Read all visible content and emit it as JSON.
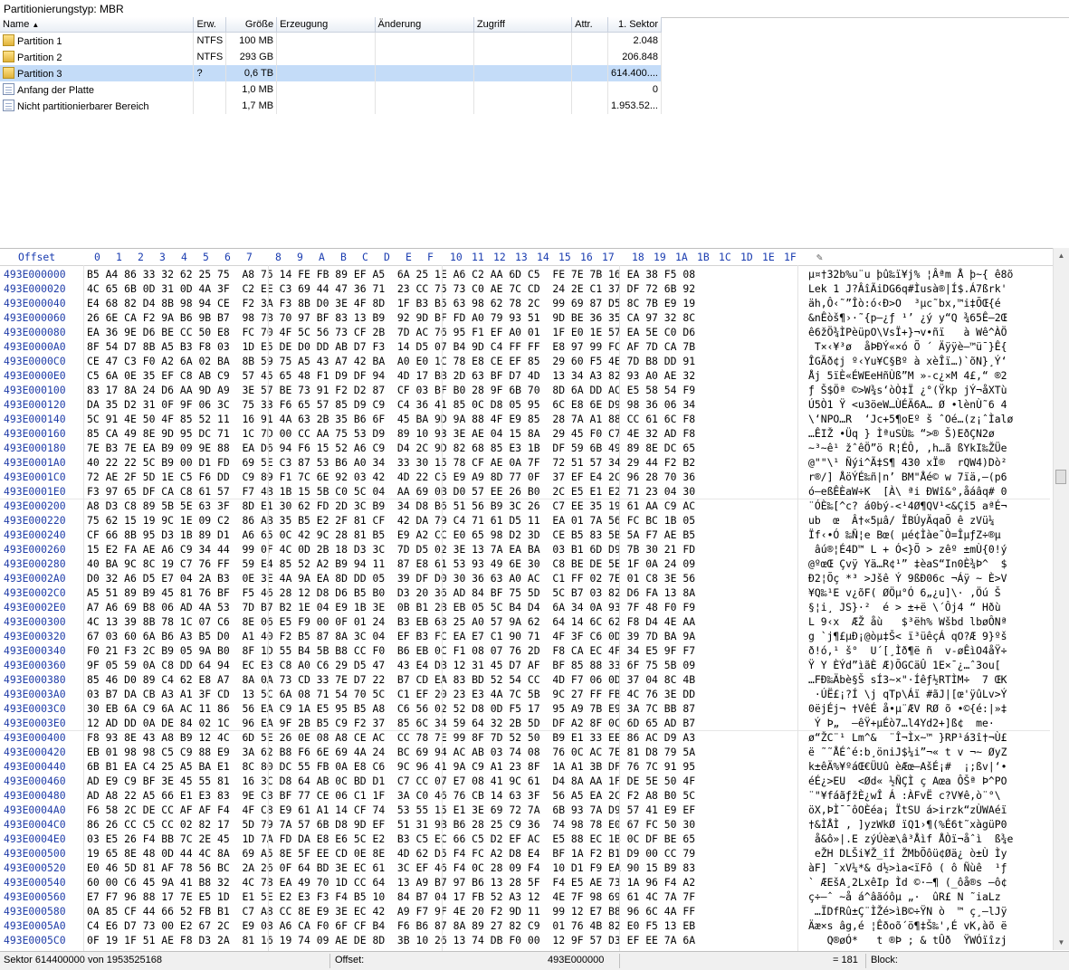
{
  "partition_type": "Partitionierungstyp: MBR",
  "columns": [
    "Name",
    "Erw.",
    "Größe",
    "Erzeugung",
    "Änderung",
    "Zugriff",
    "Attr.",
    "1. Sektor"
  ],
  "sort_indicator": "▲",
  "rows": [
    {
      "name": "Partition 1",
      "ext": "NTFS",
      "size": "100 MB",
      "sector": "2.048",
      "icon": "partition-icon"
    },
    {
      "name": "Partition 2",
      "ext": "NTFS",
      "size": "293 GB",
      "sector": "206.848",
      "icon": "partition-icon"
    },
    {
      "name": "Partition 3",
      "ext": "?",
      "size": "0,6 TB",
      "sector": "614.400....",
      "icon": "partition-icon",
      "selected": true
    },
    {
      "name": "Anfang der Platte",
      "ext": "",
      "size": "1,0 MB",
      "sector": "0",
      "icon": "file-icon"
    },
    {
      "name": "Nicht partitionierbarer Bereich",
      "ext": "",
      "size": "1,7 MB",
      "sector": "1.953.52...",
      "icon": "file-icon"
    }
  ],
  "hex_header": {
    "offset_label": "Offset",
    "cols": [
      "0",
      "1",
      "2",
      "3",
      "4",
      "5",
      "6",
      "7",
      "8",
      "9",
      "A",
      "B",
      "C",
      "D",
      "E",
      "F",
      "10",
      "11",
      "12",
      "13",
      "14",
      "15",
      "16",
      "17",
      "18",
      "19",
      "1A",
      "1B",
      "1C",
      "1D",
      "1E",
      "1F"
    ]
  },
  "hex_rows": [
    {
      "off": "493E000000",
      "hex": "B5 A4 86 33 32 62 25 75  A8 75 14 FE FB 89 EF A5  6A 25 1E A6 C2 AA 6D C5  FE 7E 7B 16 EA 38 F5 08",
      "txt": "µ¤†32b%u¨u þû‰ï¥j% ¦Âªm Å þ~{ ê8õ"
    },
    {
      "off": "493E000020",
      "hex": "4C 65 6B 0D 31 0D 4A 3F  C2 EE C3 69 44 47 36 71  23 CC 75 73 C0 AE 7C CD  24 2E C1 37 DF 72 6B 92",
      "txt": "Lek 1 J?ÂîÃiDG6q#Ìusà®|Í$.Á7ßrk'"
    },
    {
      "off": "493E000040",
      "hex": "E4 68 82 D4 8B 98 94 CE  F2 3A F3 8B D0 3E 4F 8D  1F B3 B5 63 98 62 78 2C  99 69 87 D5 8C 7B E9 19",
      "txt": "äh‚Ô‹˜”Îò:ó‹Ð>O  ³µc˜bx,™i‡ÕŒ{é "
    },
    {
      "off": "493E000060",
      "hex": "26 6E CA F2 9A B6 9B B7  98 7B 70 97 BF 83 13 B9  92 9D BF FD A0 79 93 51  9D BE 36 35 CA 97 32 8C",
      "txt": "&nÊòš¶›·˜{p—¿ƒ ¹’ ¿ý y“Q ¾65Ê—2Œ"
    },
    {
      "off": "493E000080",
      "hex": "EA 36 9E D6 BE CC 50 E8  FC 70 4F 5C 56 73 CF 2B  7D AC 76 95 F1 EF A0 01  1F E0 1E 57 EA 5E C0 D6",
      "txt": "ê6žÖ¾ÌPèüpO\\VsÏ+}¬v•ñï   à Wê^ÀÖ"
    },
    {
      "off": "493E0000A0",
      "hex": "8F 54 D7 8B A5 B3 F8 03  1D E5 DE D0 DD AB D7 F3  14 D5 07 B4 9D C4 FF FF  E8 97 99 FC AF 7D CA 7B",
      "txt": " T×‹¥³ø  åÞÐÝ«×ó Õ ´ Äÿÿè—™ü¯}Ê{"
    },
    {
      "off": "493E0000C0",
      "hex": "CE 47 C3 F0 A2 6A 02 BA  8B 59 75 A5 43 A7 42 BA  A0 E0 1C 78 E8 CE EF 85  29 60 F5 4E 7D B8 DD 91",
      "txt": "ÎGÃð¢j º‹Yu¥C§Bº à xèÎï…)`õN}¸Ý‘"
    },
    {
      "off": "493E0000E0",
      "hex": "C5 6A 0E 35 EF C8 AB C9  57 45 65 48 F1 D9 DF 94  4D 17 BB 2D 63 BF D7 4D  13 34 A3 82 93 A0 AE 32",
      "txt": "Åj 5ïÈ«ÉWEeHñÙß”M »-c¿×M 4£‚“ ®2"
    },
    {
      "off": "493E000100",
      "hex": "83 17 8A 24 D6 AA 9D A9  3E 57 BE 73 91 F2 D2 87  CF 03 BF B0 28 9F 6B 70  8D 6A DD AC E5 58 54 F9",
      "txt": "ƒ Š$Öª ©>W¾s‘òÒ‡Ï ¿°(Ÿkp jÝ¬åXTù"
    },
    {
      "off": "493E000120",
      "hex": "DA 35 D2 31 0F 9F 06 3C  75 33 F6 65 57 85 D9 C9  C4 36 41 85 0C D8 05 95  6C E8 6E D9 98 36 06 34",
      "txt": "Ú5Ò1 Ÿ <u3öeW…ÙÉÄ6A… Ø •lènÙ˜6 4"
    },
    {
      "off": "493E000140",
      "hex": "5C 91 4E 50 4F 85 52 11  16 91 4A 63 2B 35 B6 6F  45 BA 9D 9A 88 4F E9 85  28 7A A1 88 CC 61 6C F8",
      "txt": "\\‘NPO…R  ‘Jc+5¶oEº š ˆOé…(z¡ˆÌalø"
    },
    {
      "off": "493E000160",
      "hex": "85 CA 49 8E 9D 95 DC 71  1C 7D 00 CC AA 75 53 D9  89 10 93 3E AE 04 15 8A  29 45 F0 C7 4E 32 AD F8",
      "txt": "…ÊIŽ •Üq } ÌªuSÙ‰ “>® Š)EðÇN2­ø"
    },
    {
      "off": "493E000180",
      "hex": "7E B3 7E EA B9 09 9E 88  EA D6 94 F6 15 52 A6 C9  D4 2C 9D 82 68 85 E3 1B  DF 59 6B 49 89 8E DC 65",
      "txt": "~³~ê¹ žˆêÖ”ö R¦ÉÔ, ‚h…ã ßYkI‰ŽÜe"
    },
    {
      "off": "493E0001A0",
      "hex": "40 22 22 5C B9 00 D1 FD  69 5E C3 87 53 B6 A0 34  33 30 15 78 CF AE 0A 7F  72 51 57 34 29 44 F2 B2",
      "txt": "@\"\"\\¹ Ñýi^Ã‡S¶ 430 xÏ®  rQW4)Dò²"
    },
    {
      "off": "493E0001C0",
      "hex": "72 AE 2F 5D 1E C5 F6 DD  C9 89 F1 7C 6E 92 03 42  4D 22 C5 E9 A9 8D 77 0F  37 EF E4 2C 96 28 70 36",
      "txt": "r®/] ÅöÝÉ‰ñ|n’ BM\"Åé© w 7ïä,–(p6"
    },
    {
      "off": "493E0001E0",
      "hex": "F3 97 65 DF CA C8 61 57  F7 4B 1B 15 5B C0 5C 04  AA 69 0B D0 57 EE 26 B0  2C E5 E1 E2 71 23 04 30",
      "txt": "ó—eßÊÈaW÷K  [À\\ ªi ÐWî&°,åáâq# 0"
    },
    {
      "off": "493E000200",
      "hex": "A8 D3 C8 89 5B 5E 63 3F  8D E1 30 62 FD 2D 3C B9  34 D8 B6 51 56 B9 3C 26  C7 EE 35 19 61 AA C9 AC",
      "txt": "¨ÓÈ‰[^c? á0bý-<¹4Ø¶QV¹<&Çî5 aªÉ¬"
    },
    {
      "off": "493E000220",
      "hex": "75 62 15 19 9C 1E 09 C2  86 AB 35 B5 E2 2F 81 CF  42 DA 79 C4 71 61 D5 11  EA 01 7A 56 FC BC 1B 05",
      "txt": "ub  œ  Â†«5µâ/ ÏBÚyÄqaÕ ê zVü¼  "
    },
    {
      "off": "493E000240",
      "hex": "CF 66 8B 95 D3 1B 89 D1  A6 65 0C 42 9C 28 81 B5  E9 A2 CC E0 65 98 D2 3D  CE B5 83 5B 5A F7 AE B5",
      "txt": "Ïf‹•Ó ‰Ñ¦e Bœ( µé¢Ìàe˜Ò=ÎµƒZ÷®µ"
    },
    {
      "off": "493E000260",
      "hex": "15 E2 FA AE A6 C9 34 44  99 0F 4C 0D 2B 18 D3 3C  7D D5 02 3E 13 7A EA BA  03 B1 6D D9 7B 30 21 FD",
      "txt": " âú®¦É4D™ L + Ó<}Õ > zêº ±mÙ{0!ý"
    },
    {
      "off": "493E000280",
      "hex": "40 BA 9C 8C 19 C7 76 FF  59 E4 85 52 A2 B9 94 11  87 E8 61 53 93 49 6E 30  C8 BE DE 5E 1F 0A 24 09",
      "txt": "@ºœŒ Çvÿ Yä…R¢¹” ‡èaS“In0È¾Þ^  $ "
    },
    {
      "off": "493E0002A0",
      "hex": "D0 32 A6 D5 E7 04 2A B3  0E 3E 4A 9A EA 8D DD 05  39 DF D0 30 36 63 A0 AC  C1 FF 02 7E 01 C8 3E 56",
      "txt": "Ð2¦Õç *³ >Jšê Ý 9ßÐ06c ¬Áÿ ~ È>V"
    },
    {
      "off": "493E0002C0",
      "hex": "A5 51 89 B9 45 81 76 BF  F5 46 28 12 D8 D6 B5 B0  D3 20 36 AD 84 BF 75 5D  5C B7 03 82 D6 FA 13 8A",
      "txt": "¥Q‰¹E v¿õF( ØÖµ°Ó 6­„¿u]\\· ‚Öú Š"
    },
    {
      "off": "493E0002E0",
      "hex": "A7 A6 69 B8 06 AD 4A 53  7D B7 B2 1E 04 E9 1B 3E  0B B1 2B EB 05 5C B4 D4  6A 34 0A 93 7F 48 F0 F9",
      "txt": "§¦i¸ ­JS}·²  é > ±+ë \\´Ôj4 “ Hðù"
    },
    {
      "off": "493E000300",
      "hex": "4C 13 39 8B 78 1C 07 C6  8E 06 E5 F9 00 0F 01 24  B3 EB 68 25 A0 57 9A 62  64 14 6C 62 F8 D4 4E AA",
      "txt": "L 9‹x  ÆŽ åù   $³ëh% Wšbd lbøÔNª"
    },
    {
      "off": "493E000320",
      "hex": "67 03 60 6A B6 A3 B5 D0  A1 40 F2 B5 87 8A 3C 04  EF B3 FC EA E7 C1 90 71  4F 3F C6 0D 39 7D BA 9A",
      "txt": "g `j¶£µÐ¡@òµ‡Š< ï³üêçÁ qO?Æ 9}ºš"
    },
    {
      "off": "493E000340",
      "hex": "F0 21 F3 2C B9 05 9A B0  8F 1D 55 B4 5B B8 CC F0  B6 EB 0C F1 08 07 76 2D  F8 CA EC 4F 34 E5 9F F7",
      "txt": "ð!ó,¹ š°  U´[¸Ìð¶ë ñ  v-øÊìO4åŸ÷"
    },
    {
      "off": "493E000360",
      "hex": "9F 05 59 0A C8 DD 64 94  EC E3 C8 A0 C6 29 D5 47  43 E4 DB 12 31 45 D7 AF  BF 85 88 33 6F 75 5B 09",
      "txt": "Ÿ Y ÈÝd”ìãÈ Æ)ÕGCäÛ 1E×¯¿…ˆ3ou[ "
    },
    {
      "off": "493E000380",
      "hex": "85 46 D0 89 C4 62 E8 A7  8A 0A 73 CD 33 7E D7 22  B7 CD EA 83 BD 52 54 CC  4D F7 06 0D 37 04 8C 4B",
      "txt": "…FÐ‰Äbè§Š sÍ3~×\"·Íêƒ½RTÌM÷  7 ŒK"
    },
    {
      "off": "493E0003A0",
      "hex": "03 B7 DA CB A3 A1 3F CD  13 5C 6A 08 71 54 70 5C  C1 EF 20 23 E3 4A 7C 5B  9C 27 FF FB 4C 76 3E DD",
      "txt": " ·ÚË£¡?Í \\j qTp\\Áï #ãJ|[œ'ÿûLv>Ý"
    },
    {
      "off": "493E0003C0",
      "hex": "30 EB 6A C9 6A AC 11 86  56 EA C9 1A E5 95 B5 A8  C6 56 02 52 D8 0D F5 17  95 A9 7B E9 3A 7C BB 87",
      "txt": "0ëjÉj¬ †VêÉ å•µ¨ÆV RØ õ •©{é:|»‡"
    },
    {
      "off": "493E0003E0",
      "hex": "12 AD DD 0A DE 84 02 1C  96 EA 9F 2B B5 C9 F2 37  85 6C 34 59 64 32 2B 5D  DF A2 8F 0C 6D 65 AD B7",
      "txt": " ­Ý Þ„  –êŸ+µÉò7…l4Yd2+]ß¢  me­·"
    },
    {
      "off": "493E000400",
      "hex": "F8 93 8E 43 A8 B9 12 4C  6D 5E 26 0E 08 A8 CE AC  CC 78 7E 99 8F 7D 52 50  B9 E1 33 EE 86 AC D9 A3",
      "txt": "ø“ŽC¨¹ Lm^&  ¨Î¬Ìx~™ }RP¹á3î†¬Ù£"
    },
    {
      "off": "493E000420",
      "hex": "EB 01 98 98 C5 C9 88 E9  3A 62 B8 F6 6E 69 4A 24  BC 69 94 AC AB 03 74 08  76 0C AC 7E 81 D8 79 5A",
      "txt": "ë ˜˜ÅÉˆé:b¸öniJ$¼i”¬« t v ¬~ ØyZ"
    },
    {
      "off": "493E000440",
      "hex": "6B B1 EA C4 25 A5 BA E1  8C 80 DC 55 FB 0A E8 C6  9C 96 41 9A C9 A1 23 8F  1A A1 3B DF 76 7C 91 95",
      "txt": "k±êÄ%¥ºáŒ€ÜUû èÆœ–AšÉ¡#  ¡;ßv|‘•"
    },
    {
      "off": "493E000460",
      "hex": "AD E9 C9 BF 3E 45 55 81  16 3C D8 64 AB 0C BD D1  C7 CC 07 E7 08 41 9C 61  D4 8A AA 1F DE 5E 50 4F",
      "txt": "­éÉ¿>EU  <Ød« ½ÑÇÌ ç Aœa ÔŠª Þ^PO"
    },
    {
      "off": "493E000480",
      "hex": "AD A8 22 A5 66 E1 E3 83  9E C8 BF 77 CE 06 C1 1F  3A C0 46 76 CB 14 63 3F  56 A5 EA 2C F2 A8 B0 5C",
      "txt": "­¨\"¥fáãƒžÈ¿wÎ Á :ÀFvË c?V¥ê,ò¨°\\"
    },
    {
      "off": "493E0004A0",
      "hex": "F6 58 2C DE CC AF AF F4  4F C8 E9 61 A1 14 CF 74  53 55 15 E1 3E 69 72 7A  6B 93 7A D9 57 41 E9 EF",
      "txt": "öX,ÞÌ¯¯ôOÈéa¡ ÏtSU á>irzk“zÙWAéï"
    },
    {
      "off": "493E0004C0",
      "hex": "86 26 CC C5 CC 02 82 17  5D 79 7A 57 6B D8 9D EF  51 31 9B B6 28 25 C9 36  74 98 78 E0 67 FC 50 30",
      "txt": "†&ÌÅÌ ‚ ]yzWkØ ïQ1›¶(%É6t˜xàgüP0"
    },
    {
      "off": "493E0004E0",
      "hex": "03 E5 26 F4 BB 7C 2E 45  1D 7A FD DA E8 E6 5C E2  B3 C5 EC 66 C5 D2 EF AC  E5 88 EC 1B 0C DF BE 65",
      "txt": " å&ô»|.E zýÚèæ\\â³Åìf ÅÒï¬åˆì  ß¾e"
    },
    {
      "off": "493E000500",
      "hex": "19 65 8E 48 0D 44 4C 8A  69 A5 8E 5F EE CD 0E 8E  4D 62 D5 F4 FC A2 D8 E4  BF 1A F2 B1 D9 00 CC 79",
      "txt": " eŽH DLŠi¥Ž_îÍ ŽMbÕôü¢Øä¿ ò±Ù Ìy"
    },
    {
      "off": "493E000520",
      "hex": "E0 46 5D 81 AF 78 56 BC  2A 26 0F 64 BD 3E EC 61  3C EF 46 F4 0C 28 09 F4  10 D1 F9 EA 90 15 B9 83",
      "txt": "àF] ¯xV¼*& d½>ìa<ïFô ( ô Ñùê  ¹ƒ"
    },
    {
      "off": "493E000540",
      "hex": "60 00 C6 45 9A 41 B8 32  4C 78 EA 49 70 1D CC 64  13 A9 B7 97 B6 13 28 5F  F4 E5 AE 73 1A 96 F4 A2",
      "txt": "` ÆEšA¸2LxêIp Ìd ©·—¶ (_ôå®s –ô¢"
    },
    {
      "off": "493E000560",
      "hex": "E7 F7 96 88 17 7E E5 1D  E1 5E E2 E3 F3 F4 B5 10  84 B7 04 17 FB 52 A3 12  4E 7F 98 69 61 4C 7A 7F",
      "txt": "ç÷–ˆ ~å á^âãóôµ „·  ûR£ N ˜iaLz "
    },
    {
      "off": "493E000580",
      "hex": "0A 85 CF 44 66 52 FB B1  C7 A8 CC 8E E9 3E EC 42  A9 F7 9F 4E 20 F2 9D 11  99 12 E7 B8 96 6C 4A FF",
      "txt": " …ÏDfRû±Ç¨ÌŽé>ìB©÷ŸN ò  ™ ç¸–lJÿ"
    },
    {
      "off": "493E0005A0",
      "hex": "C4 E6 D7 73 00 E2 67 2C  E9 08 A6 CA F0 6F CF B4  F6 B6 87 8A 89 27 82 C9  01 76 4B 82 E0 F5 13 EB",
      "txt": "Äæ×s âg,é ¦Êðoõ´ö¶‡Š‰'‚É vK‚àõ ë"
    },
    {
      "off": "493E0005C0",
      "hex": "0F 19 1F 51 AE F8 D3 2A  81 16 19 74 09 AE DE 8D  3B 10 26 13 74 DB F0 00  12 9F 57 D3 EF EE 7A 6A",
      "txt": "   Q®øÓ*   t ®Þ ; & tÛð  ŸWÓïîzj"
    }
  ],
  "status": {
    "sector": "Sektor 614400000 von 1953525168",
    "offset_label": "Offset:",
    "offset_value": "493E000000",
    "eq": "= 181",
    "block": "Block:"
  }
}
